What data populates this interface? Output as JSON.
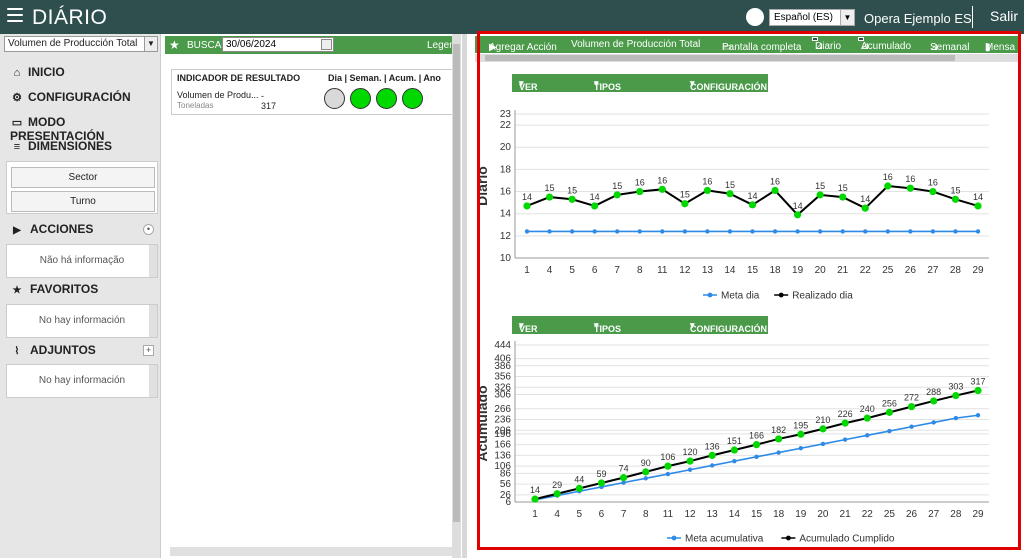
{
  "app": {
    "title": "DIÁRIO",
    "language": "Español (ES)",
    "user": "Opera Ejemplo ES",
    "exit": "Salir"
  },
  "sidebar": {
    "indicator_select": "Volumen de Producción Total",
    "nav": [
      {
        "label": "INICIO",
        "icon": "home-icon"
      },
      {
        "label": "CONFIGURACIÓN",
        "icon": "gear-icon"
      },
      {
        "label": "MODO PRESENTACIÓN",
        "icon": "monitor-icon"
      },
      {
        "label": "DIMENSIONES",
        "icon": "database-icon"
      }
    ],
    "dimensions": [
      "Sector",
      "Turno"
    ],
    "sections": [
      {
        "label": "ACCIONES",
        "empty": "Não há informação"
      },
      {
        "label": "FAVORITOS",
        "empty": "No hay información"
      },
      {
        "label": "ADJUNTOS",
        "empty": "No hay información"
      }
    ]
  },
  "middle": {
    "search_label": "BUSCA",
    "date": "30/06/2024",
    "legend": "Legend",
    "col_indicator": "INDICADOR DE RESULTADO",
    "col_periods": "Dia | Seman. | Acum. | Ano",
    "row": {
      "name": "Volumen de Produ...",
      "unit": "Toneladas",
      "dash": "-",
      "value": "317"
    },
    "status_colors": [
      "#d9d9d9",
      "#00d800",
      "#00d800",
      "#00d800"
    ]
  },
  "right": {
    "toolbar": {
      "add_action": "Agregar Acción",
      "indicator": "Volumen de Producción Total",
      "fullscreen": "Pantalla completa",
      "daily": "Diario",
      "cumulative": "Acumulado",
      "weekly": "Semanal",
      "monthly": "Mensa"
    },
    "chart_menu": {
      "values": "VER VALORES",
      "types": "TIPOS DE GRÁFICO",
      "config": "CONFIGURACIÓN"
    }
  },
  "colors": {
    "topbar": "#2f4f4f",
    "green": "#4a9a4a",
    "highlight": "#e00000",
    "meta": "#2e8ae6",
    "realizado": "#000000",
    "point": "#00d800"
  },
  "chart_data": [
    {
      "type": "line",
      "ylabel": "Diario",
      "categories": [
        "1",
        "4",
        "5",
        "6",
        "7",
        "8",
        "11",
        "12",
        "13",
        "14",
        "15",
        "18",
        "19",
        "20",
        "21",
        "22",
        "25",
        "26",
        "27",
        "28",
        "29"
      ],
      "ylim": [
        10,
        23
      ],
      "yticks": [
        10,
        12,
        14,
        16,
        18,
        20,
        22,
        23
      ],
      "series": [
        {
          "name": "Meta dia",
          "color": "#2e8ae6",
          "values": [
            12.4,
            12.4,
            12.4,
            12.4,
            12.4,
            12.4,
            12.4,
            12.4,
            12.4,
            12.4,
            12.4,
            12.4,
            12.4,
            12.4,
            12.4,
            12.4,
            12.4,
            12.4,
            12.4,
            12.4,
            12.4
          ]
        },
        {
          "name": "Realizado dia",
          "color": "#000000",
          "values": [
            14.7,
            15.5,
            15.3,
            14.7,
            15.7,
            16.0,
            16.2,
            14.9,
            16.1,
            15.8,
            14.8,
            16.1,
            13.9,
            15.7,
            15.5,
            14.5,
            16.5,
            16.3,
            16.0,
            15.3,
            14.7
          ]
        }
      ],
      "data_labels": [
        14,
        15,
        15,
        14,
        15,
        16,
        16,
        15,
        16,
        15,
        14,
        16,
        14,
        15,
        15,
        14,
        16,
        16,
        16,
        15,
        14
      ],
      "legend": "bottom"
    },
    {
      "type": "line",
      "ylabel": "Acumulado",
      "categories": [
        "1",
        "4",
        "5",
        "6",
        "7",
        "8",
        "11",
        "12",
        "13",
        "14",
        "15",
        "18",
        "19",
        "20",
        "21",
        "22",
        "25",
        "26",
        "27",
        "28",
        "29"
      ],
      "ylim": [
        6,
        444
      ],
      "yticks": [
        6,
        26,
        56,
        86,
        106,
        136,
        166,
        196,
        206,
        236,
        266,
        306,
        326,
        356,
        386,
        406,
        444
      ],
      "series": [
        {
          "name": "Meta acumulativa",
          "color": "#2e8ae6",
          "values": [
            12,
            24,
            36,
            48,
            60,
            72,
            84,
            96,
            108,
            120,
            132,
            144,
            156,
            168,
            180,
            192,
            204,
            216,
            228,
            240,
            248
          ]
        },
        {
          "name": "Acumulado Cumplido",
          "color": "#000000",
          "values": [
            14,
            29,
            44,
            59,
            74,
            90,
            106,
            120,
            136,
            151,
            166,
            182,
            195,
            210,
            226,
            240,
            256,
            272,
            288,
            303,
            317
          ]
        }
      ],
      "data_labels": [
        14,
        29,
        44,
        59,
        74,
        90,
        106,
        120,
        136,
        151,
        166,
        182,
        195,
        210,
        226,
        240,
        256,
        272,
        288,
        303,
        317
      ],
      "legend": "bottom"
    }
  ]
}
